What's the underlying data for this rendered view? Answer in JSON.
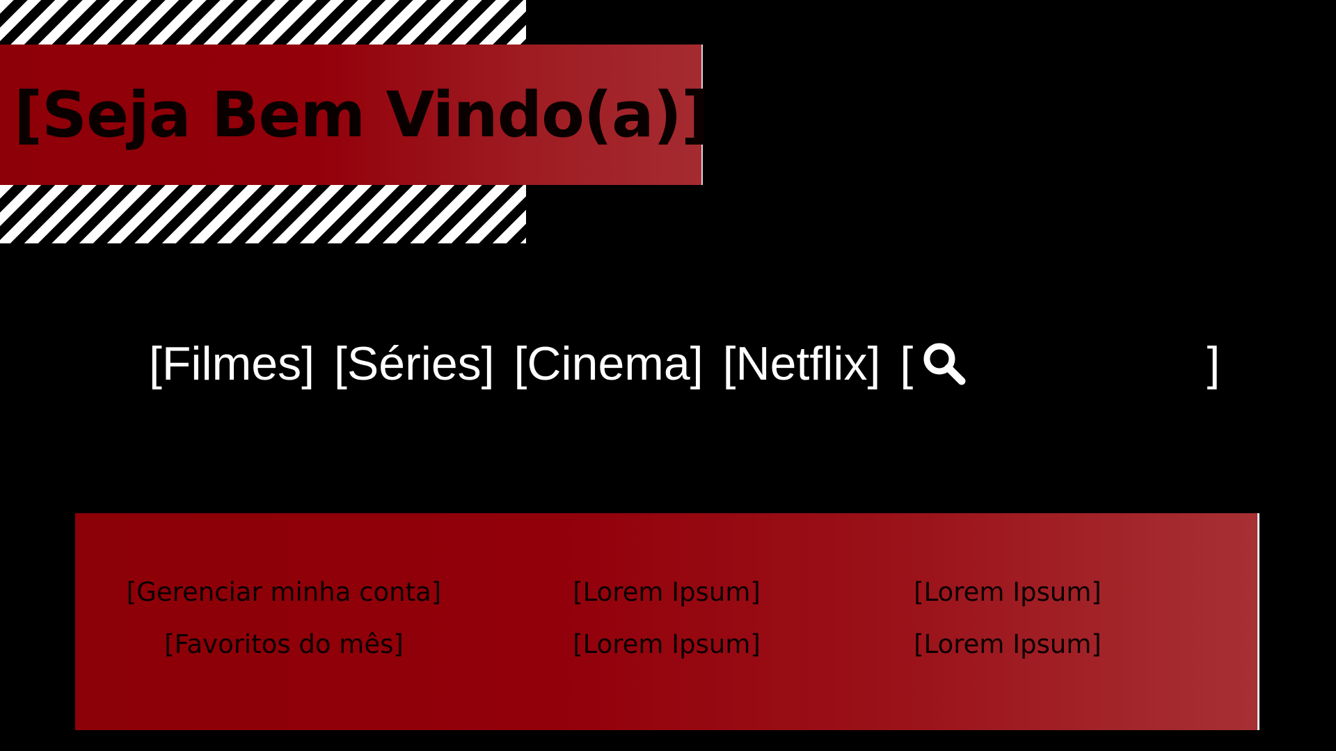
{
  "header": {
    "welcome": "[Seja Bem Vindo(a)]"
  },
  "nav": {
    "items": [
      {
        "label": "[Filmes]"
      },
      {
        "label": "[Séries]"
      },
      {
        "label": "[Cinema]"
      },
      {
        "label": "[Netflix]"
      }
    ],
    "search": {
      "open_bracket": "[",
      "close_bracket": "]",
      "icon": "search-icon"
    }
  },
  "footer": {
    "links": [
      [
        "[Gerenciar minha conta]",
        "[Lorem Ipsum]",
        "[Lorem Ipsum]"
      ],
      [
        "[Favoritos do mês]",
        "[Lorem Ipsum]",
        "[Lorem Ipsum]"
      ]
    ]
  },
  "colors": {
    "background": "#000000",
    "accent_red": "#93000a",
    "text_light": "#ffffff",
    "text_dark": "#0a0000"
  }
}
